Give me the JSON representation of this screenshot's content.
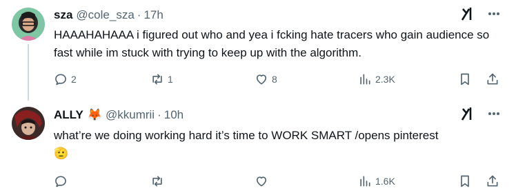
{
  "tweets": [
    {
      "display_name": "sza",
      "handle": "@cole_sza",
      "separator": "·",
      "time": "17h",
      "text": "HAAAHAHAAA i figured out who and yea i fcking hate tracers who gain audience so fast while im stuck with trying to keep up with the algorithm.",
      "replies": "2",
      "reposts": "1",
      "likes": "8",
      "views": "2.3K"
    },
    {
      "display_name": "ALLY",
      "name_emoji": "🦊",
      "handle": "@kkumrii",
      "separator": "·",
      "time": "10h",
      "text": "what’re we doing working hard it’s time to WORK SMART /opens pinterest",
      "text_emoji": "🫡",
      "replies": "",
      "reposts": "",
      "likes": "",
      "views": "1.6K"
    }
  ],
  "icons": {
    "grok": "grok-icon",
    "more": "more-icon",
    "reply": "reply-icon",
    "repost": "repost-icon",
    "like": "heart-icon",
    "views": "views-icon",
    "bookmark": "bookmark-icon",
    "share": "share-icon"
  },
  "colors": {
    "text": "#0f1419",
    "secondary": "#536471",
    "thread_line": "#cfd9de",
    "background": "#ffffff"
  }
}
